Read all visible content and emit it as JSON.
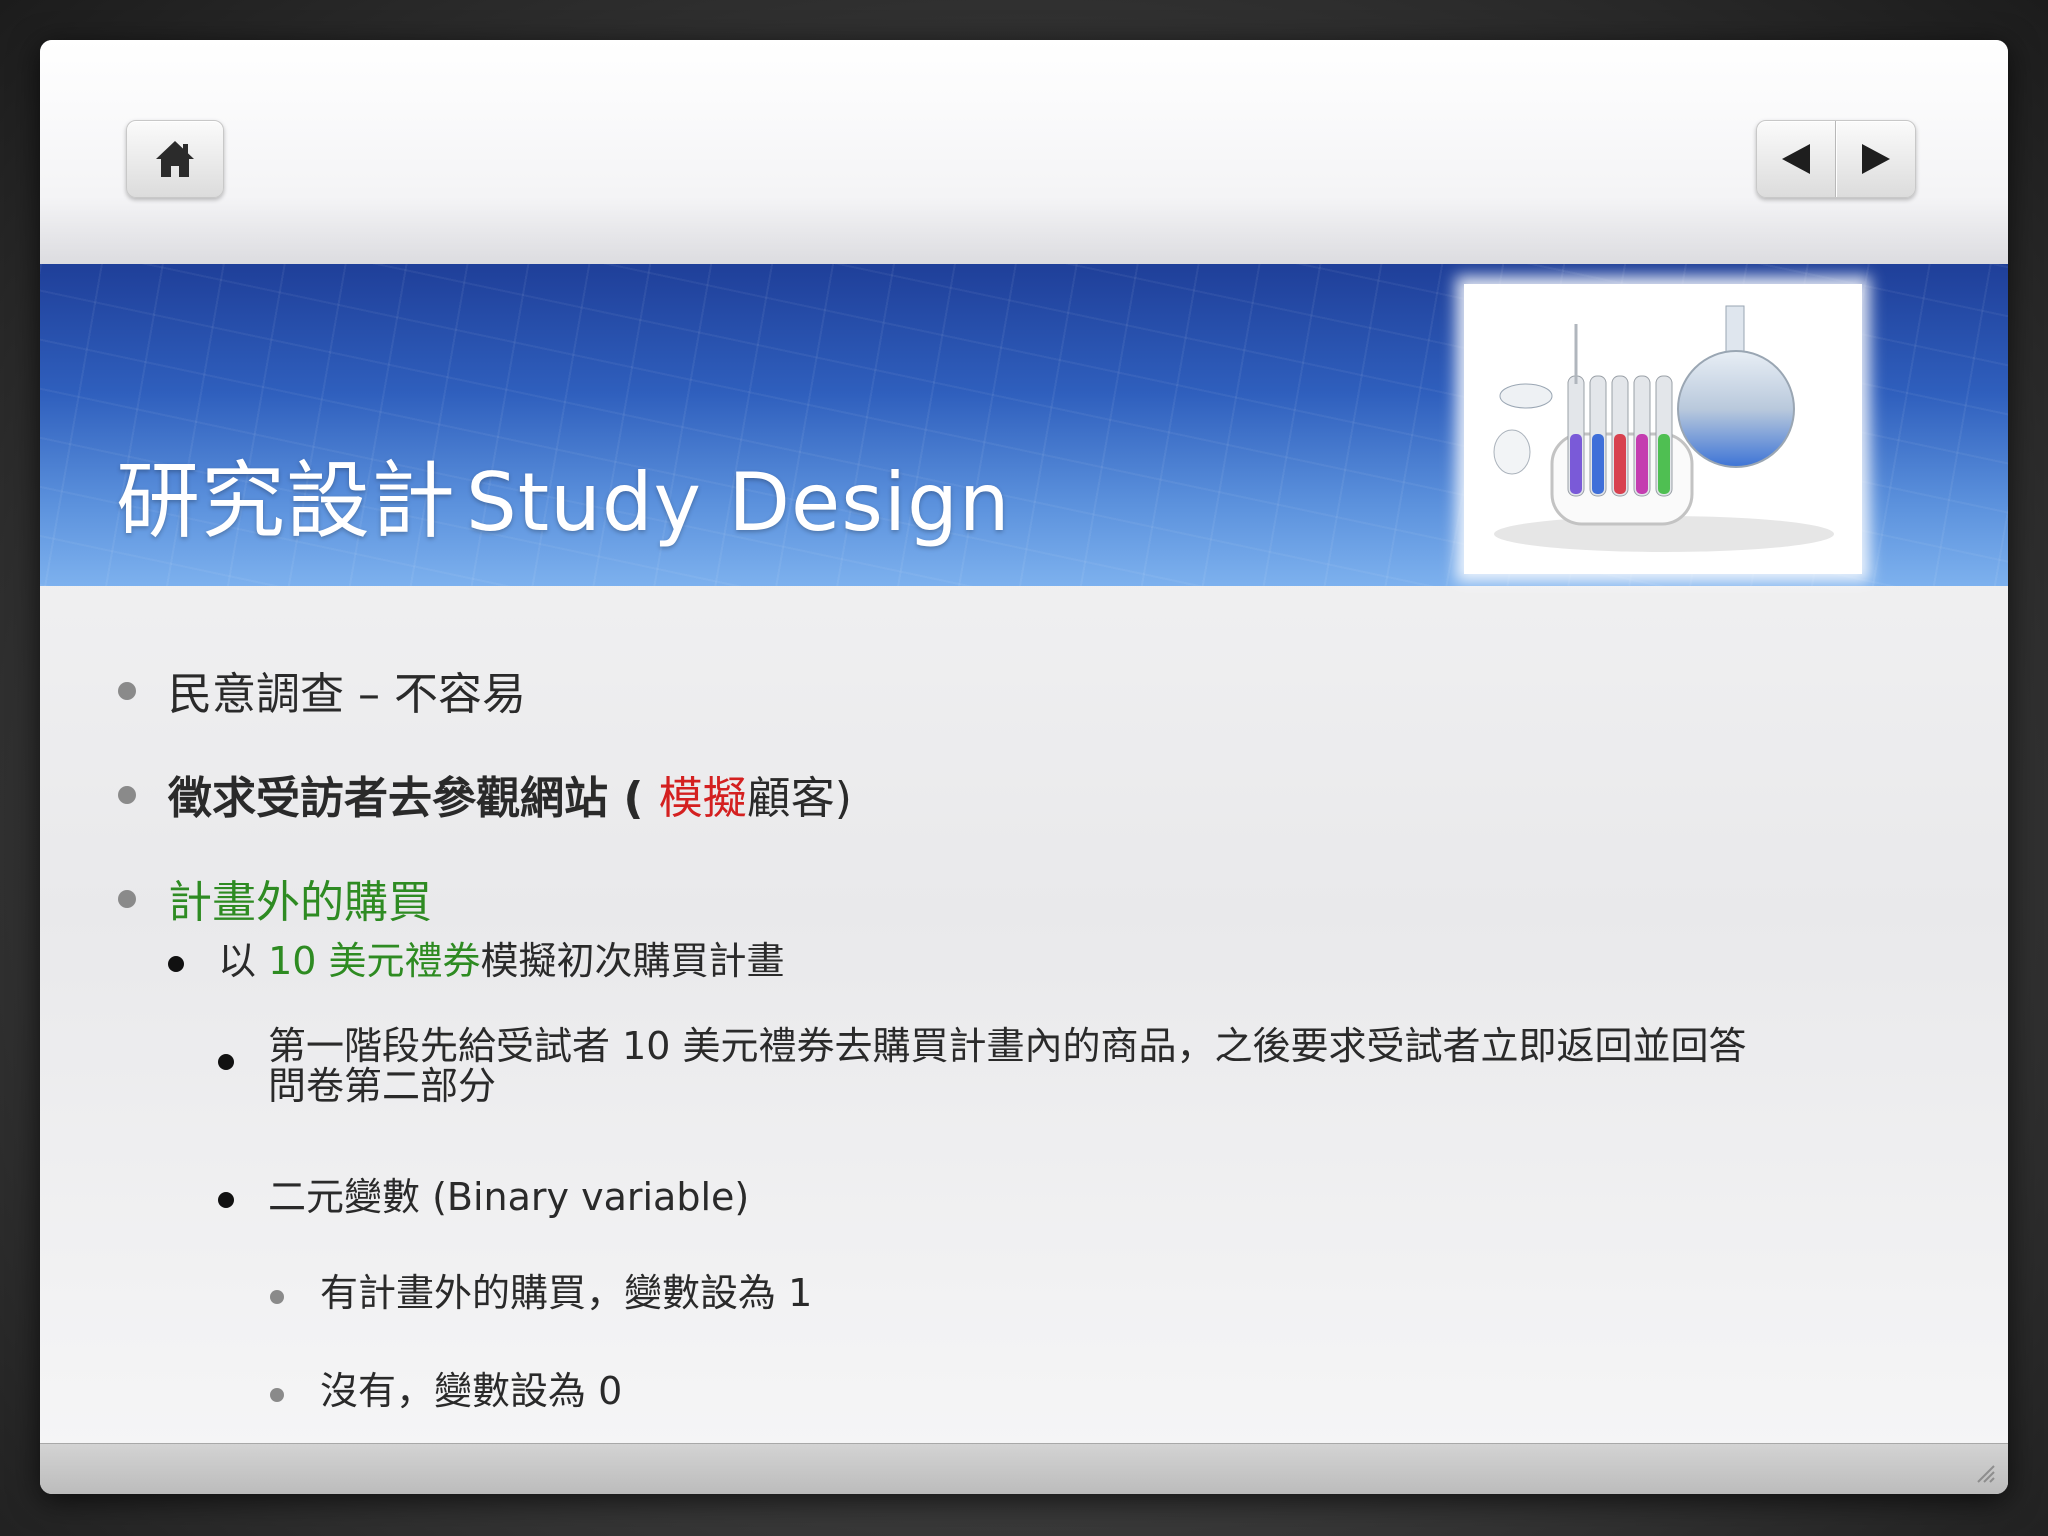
{
  "toolbar": {
    "home_icon": "home-icon",
    "prev_icon": "triangle-left-icon",
    "next_icon": "triangle-right-icon"
  },
  "slide": {
    "title_zh": "研究設計",
    "title_en": "Study Design",
    "bullets": [
      {
        "text": "民意調查 – 不容易"
      },
      {
        "pre": "徵求受訪者去參觀網站 ( ",
        "highlight": "模擬",
        "post": "顧客)"
      },
      {
        "text": "計畫外的購買"
      }
    ],
    "sub": {
      "pre": "以 ",
      "highlight": "10 美元禮券",
      "post": "模擬初次購買計畫"
    },
    "sub_sub": [
      {
        "line1": "第一階段先給受試者 10 美元禮券去購買計畫內的商品，之後要求受試者立即返回並回答",
        "line2": "問卷第二部分"
      },
      {
        "line1": "二元變數 (Binary variable)"
      }
    ],
    "fourth": [
      {
        "text": "有計畫外的購買，變數設為 1"
      },
      {
        "text": "沒有，變數設為 0"
      }
    ]
  },
  "colors": {
    "banner_dark": "#1f3f99",
    "banner_light": "#7db1ee",
    "accent_green": "#2e8b22",
    "accent_red": "#d42020"
  }
}
